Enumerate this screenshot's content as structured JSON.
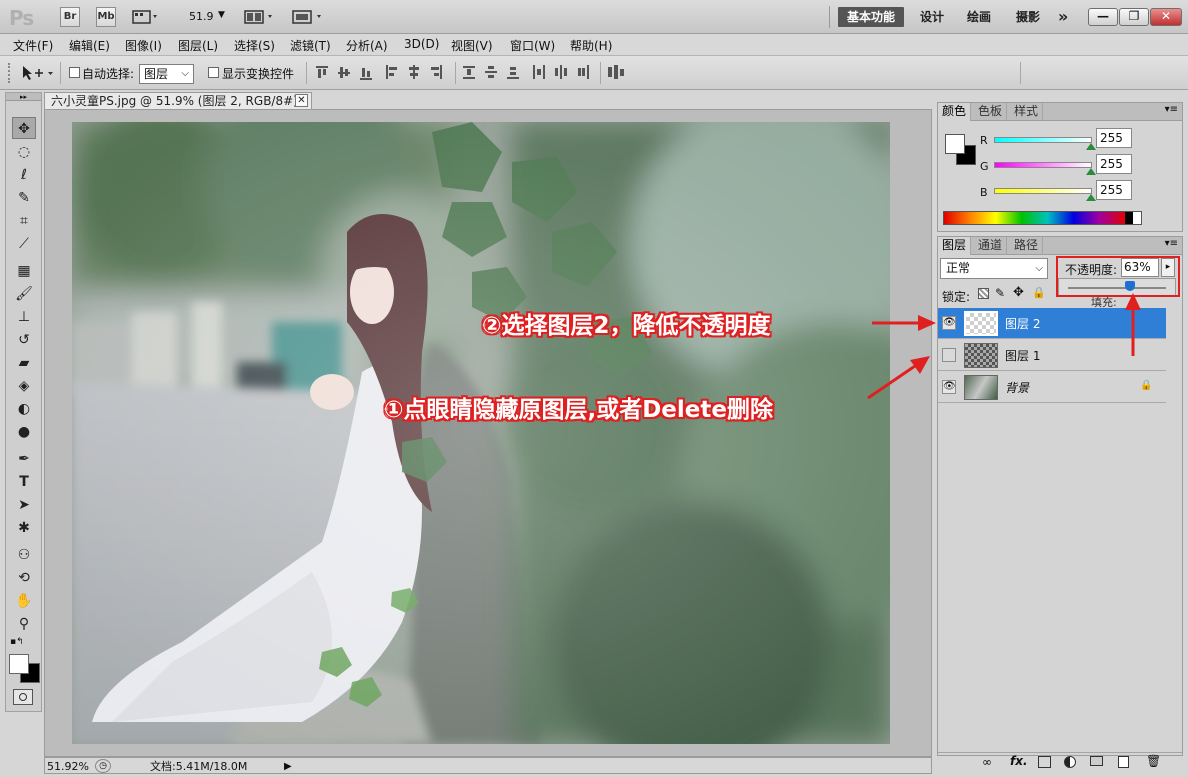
{
  "app": {
    "logo": "Ps",
    "bridge_label": "Br",
    "minibridge_label": "Mb",
    "zoom_value": "51.9",
    "workspaces": [
      "基本功能",
      "设计",
      "绘画",
      "摄影"
    ],
    "more_label": "»",
    "window_controls": {
      "minimize": "—",
      "restore": "❐",
      "close": "✕"
    }
  },
  "menu": [
    "文件(F)",
    "编辑(E)",
    "图像(I)",
    "图层(L)",
    "选择(S)",
    "滤镜(T)",
    "分析(A)",
    "3D(D)",
    "视图(V)",
    "窗口(W)",
    "帮助(H)"
  ],
  "options": {
    "auto_select_label": "自动选择:",
    "auto_select_target": "图层",
    "show_transform_label": "显示变换控件"
  },
  "document": {
    "tab_title": "六小灵童PS.jpg @ 51.9% (图层 2, RGB/8#) *",
    "status_zoom": "51.92%",
    "status_doc": "文档:5.41M/18.0M"
  },
  "color_panel": {
    "tabs": [
      "颜色",
      "色板",
      "样式"
    ],
    "channels": [
      {
        "label": "R",
        "value": "255",
        "gradient": "#00ffff"
      },
      {
        "label": "G",
        "value": "255",
        "gradient": "#ff00ff"
      },
      {
        "label": "B",
        "value": "255",
        "gradient": "#ffff00"
      }
    ]
  },
  "layers_panel": {
    "tabs": [
      "图层",
      "通道",
      "路径"
    ],
    "blend_mode": "正常",
    "opacity_label": "不透明度:",
    "opacity_value": "63%",
    "opacity_level": 0.63,
    "lock_label": "锁定:",
    "layers": [
      {
        "name": "图层 2",
        "visible": true,
        "selected": true
      },
      {
        "name": "图层 1",
        "visible": false,
        "selected": false
      },
      {
        "name": "背景",
        "visible": true,
        "selected": false,
        "locked": true
      }
    ],
    "footer_icons": [
      "link-icon",
      "fx-icon",
      "mask-icon",
      "adjustment-icon",
      "group-icon",
      "new-layer-icon",
      "trash-icon"
    ]
  },
  "annotations": {
    "step2": "②选择图层2，降低不透明度",
    "step1": "①点眼睛隐藏原图层,或者Delete删除",
    "color": "#e02020"
  }
}
